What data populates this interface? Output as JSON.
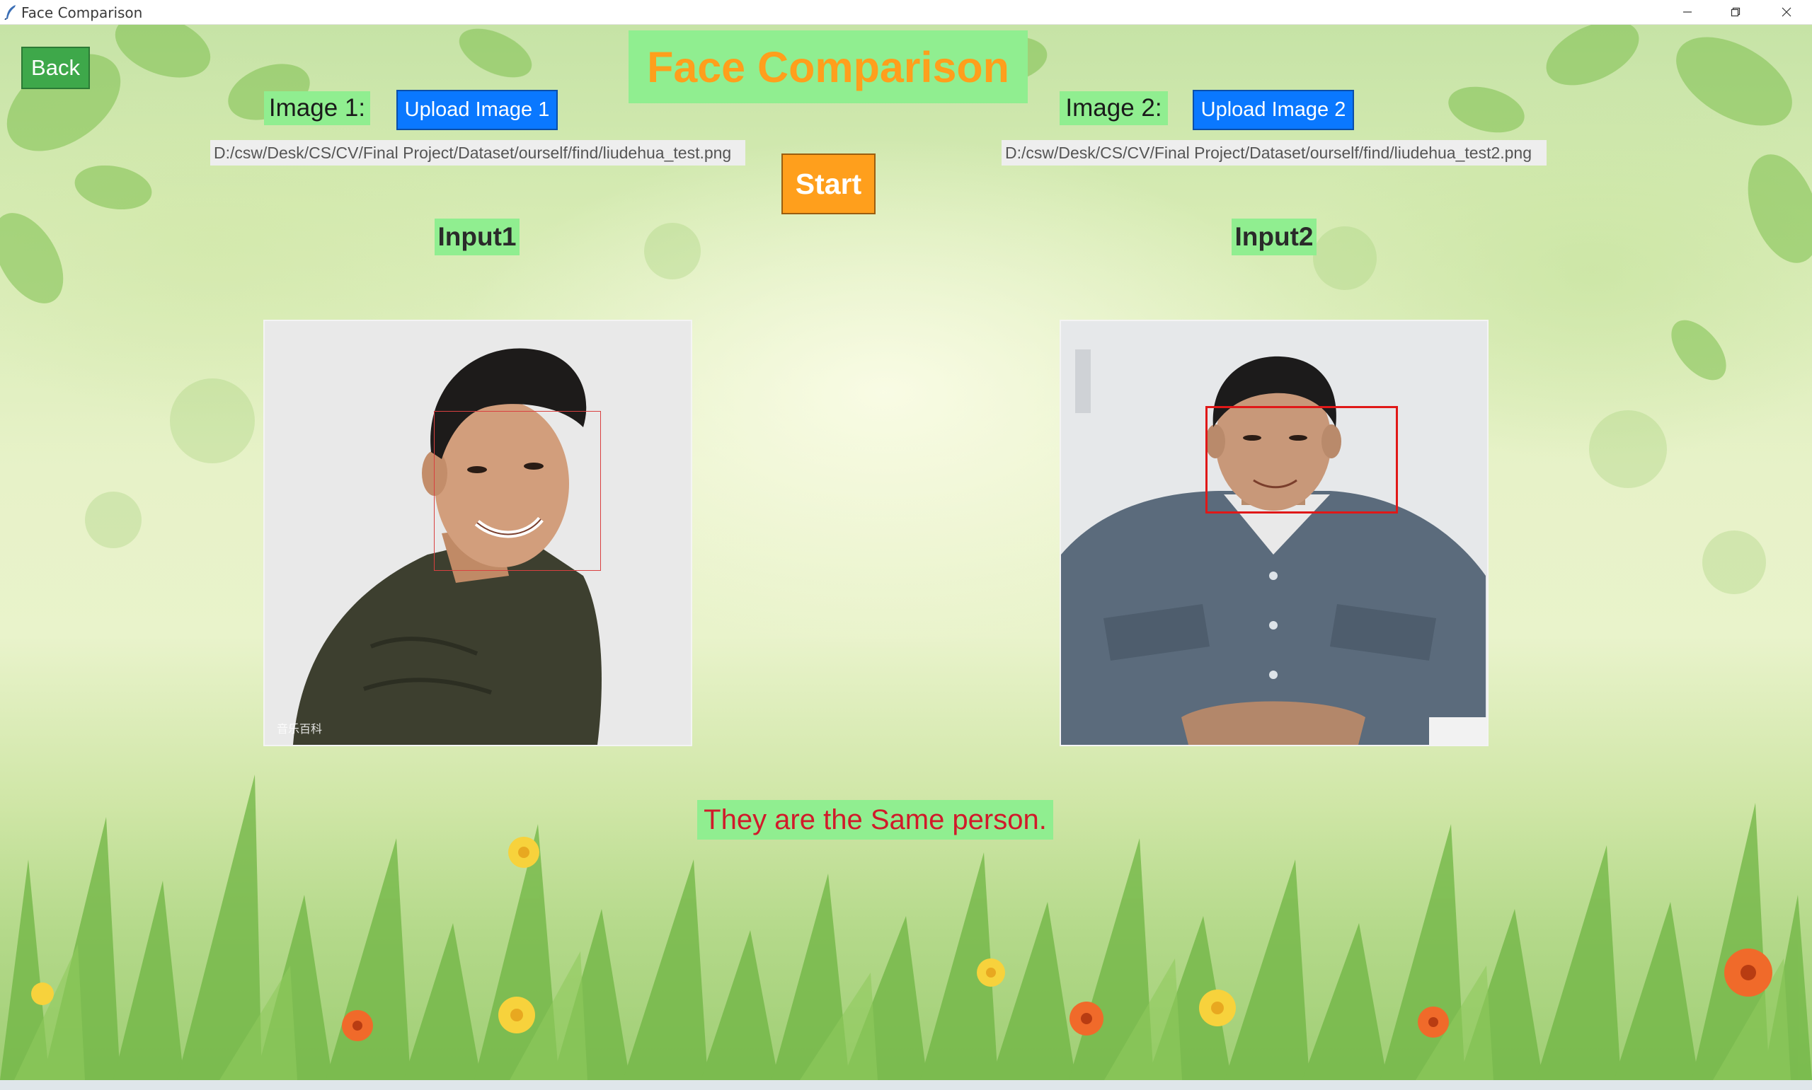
{
  "window": {
    "title": "Face Comparison",
    "controls": [
      "minimize-icon",
      "restore-icon",
      "close-icon"
    ]
  },
  "toolbar": {
    "back_label": "Back",
    "heading": "Face Comparison",
    "start_label": "Start"
  },
  "image1": {
    "label": "Image 1:",
    "upload_label": "Upload Image 1",
    "path": "D:/csw/Desk/CS/CV/Final Project/Dataset/ourself/find/liudehua_test.png",
    "caption": "Input1",
    "watermark": "音乐百科"
  },
  "image2": {
    "label": "Image 2:",
    "upload_label": "Upload Image 2",
    "path": "D:/csw/Desk/CS/CV/Final Project/Dataset/ourself/find/liudehua_test2.png",
    "caption": "Input2"
  },
  "result": {
    "text": "They are the Same person."
  },
  "colors": {
    "label_bg": "#90ee90",
    "heading_text": "#ff9f1c",
    "start_bg": "#ff9f1c",
    "upload_bg": "#0a78ff",
    "back_bg": "#3ea84a",
    "result_text": "#d11a2a",
    "face_box": "#e01818"
  }
}
